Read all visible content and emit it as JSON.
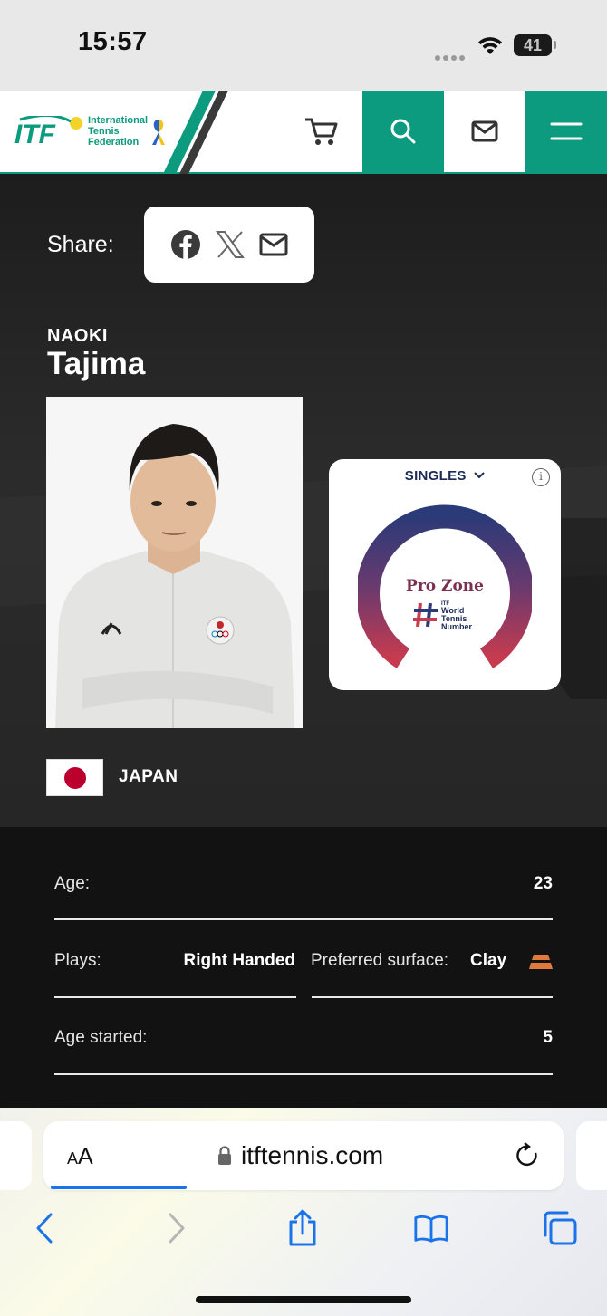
{
  "status_bar": {
    "time": "15:57",
    "battery": "41"
  },
  "header": {
    "logo": "ITF",
    "logo_subtitle": [
      "International",
      "Tennis",
      "Federation"
    ],
    "icons": [
      "cart-icon",
      "search-icon",
      "mail-icon",
      "menu-icon"
    ],
    "accent_color": "#0c9b7e"
  },
  "share": {
    "label": "Share:",
    "icons": [
      "facebook-icon",
      "x-icon",
      "email-icon"
    ]
  },
  "player": {
    "first_name": "NAOKI",
    "last_name": "Tajima",
    "country": "JAPAN"
  },
  "wtn_card": {
    "mode": "SINGLES",
    "zone": "Pro Zone",
    "logo_text": [
      "ITF",
      "World",
      "Tennis",
      "Number"
    ]
  },
  "stats": {
    "age_label": "Age:",
    "age_value": "23",
    "plays_label": "Plays:",
    "plays_value": "Right Handed",
    "surface_label": "Preferred surface:",
    "surface_value": "Clay",
    "age_started_label": "Age started:",
    "age_started_value": "5"
  },
  "browser": {
    "text_size_label": "AA",
    "url": "itftennis.com",
    "toolbar": [
      "back-icon",
      "forward-icon",
      "share-icon",
      "bookmarks-icon",
      "tabs-icon"
    ]
  }
}
